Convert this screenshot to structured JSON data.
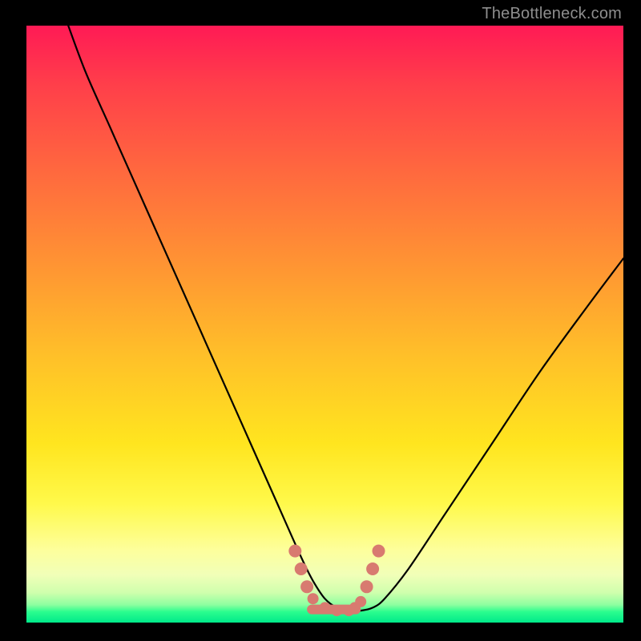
{
  "watermark": "TheBottleneck.com",
  "colors": {
    "frame": "#000000",
    "grad_top": "#ff1a55",
    "grad_mid1": "#ff9433",
    "grad_mid2": "#ffe51f",
    "grad_bottom": "#00e98a",
    "curve": "#000000",
    "marker": "#d87a70",
    "watermark": "#8e8e8e"
  },
  "chart_data": {
    "type": "line",
    "title": "",
    "xlabel": "",
    "ylabel": "",
    "xlim": [
      0,
      100
    ],
    "ylim": [
      0,
      100
    ],
    "series": [
      {
        "name": "bottleneck-curve",
        "x": [
          7,
          10,
          14,
          18,
          22,
          26,
          30,
          34,
          38,
          42,
          46,
          48,
          50,
          52,
          54,
          56,
          58,
          60,
          64,
          70,
          78,
          86,
          94,
          100
        ],
        "y": [
          100,
          92,
          83,
          74,
          65,
          56,
          47,
          38,
          29,
          20,
          11,
          7,
          4,
          2.5,
          2,
          2,
          2.5,
          4,
          9,
          18,
          30,
          42,
          53,
          61
        ]
      }
    ],
    "markers": {
      "name": "highlight-points",
      "x": [
        45,
        46,
        47,
        48,
        50,
        52,
        54,
        55,
        56,
        57,
        58,
        59
      ],
      "y": [
        12,
        9,
        6,
        4,
        2.5,
        2,
        2,
        2.5,
        3.5,
        6,
        9,
        12
      ]
    }
  }
}
